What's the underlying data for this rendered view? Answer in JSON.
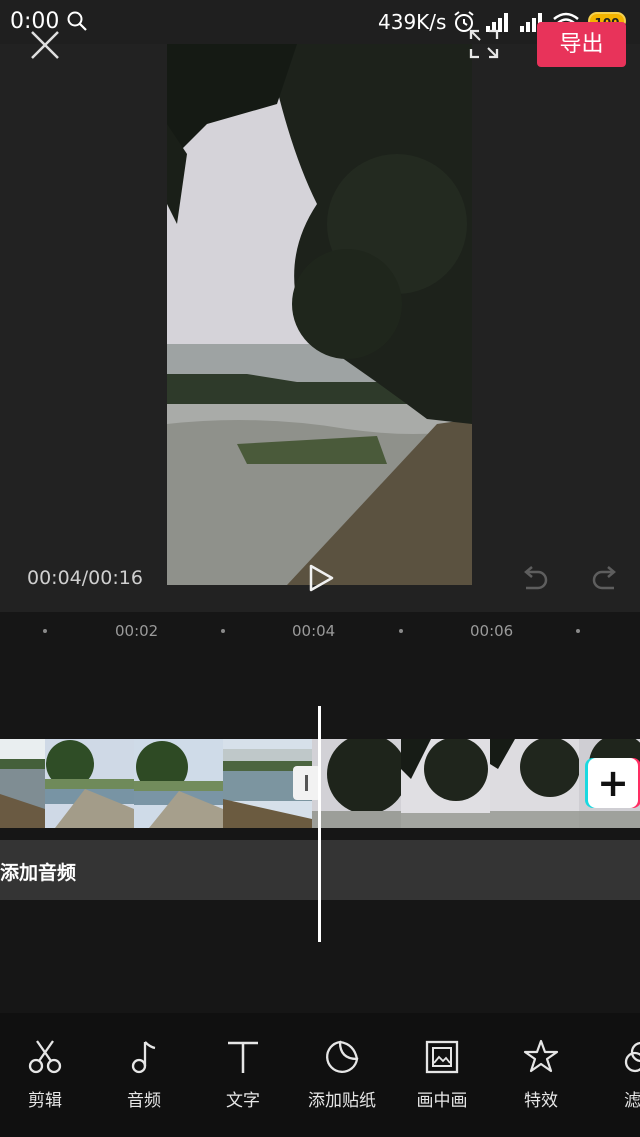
{
  "status_bar": {
    "time": "0:00",
    "net_speed": "439K/s",
    "battery": "100"
  },
  "header": {
    "export_label": "导出"
  },
  "playback": {
    "timecode": "00:04/00:16"
  },
  "ruler": {
    "ticks": [
      "00:02",
      "00:04",
      "00:06"
    ]
  },
  "audio_track": {
    "label": "添加音频"
  },
  "toolbar": {
    "items": [
      {
        "label": "剪辑",
        "icon": "scissors-icon"
      },
      {
        "label": "音频",
        "icon": "music-note-icon"
      },
      {
        "label": "文字",
        "icon": "text-icon"
      },
      {
        "label": "添加贴纸",
        "icon": "sticker-icon"
      },
      {
        "label": "画中画",
        "icon": "picture-in-picture-icon"
      },
      {
        "label": "特效",
        "icon": "effects-star-icon"
      },
      {
        "label": "滤",
        "icon": "filter-icon"
      }
    ]
  },
  "colors": {
    "accent": "#e8335a",
    "background": "#161616",
    "preview_bg": "#222222"
  }
}
